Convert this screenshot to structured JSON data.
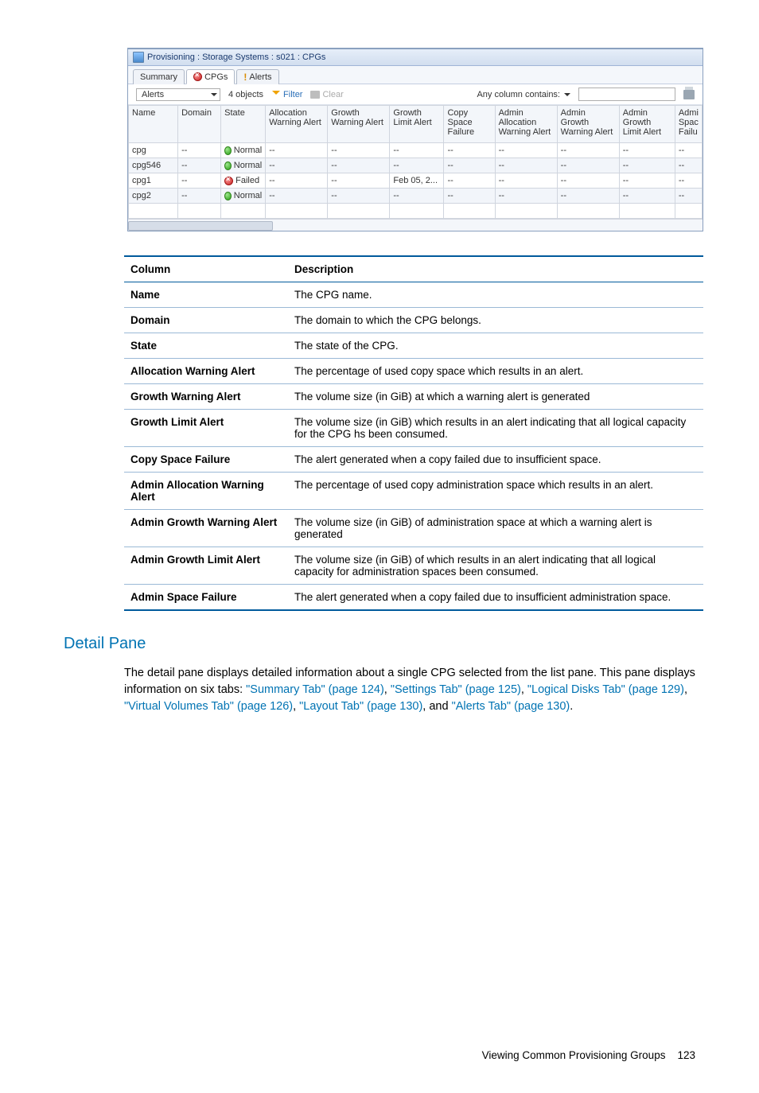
{
  "screenshot": {
    "title": "Provisioning : Storage Systems : s021 : CPGs",
    "tabs": [
      {
        "label": "Summary",
        "icon": "",
        "active": false
      },
      {
        "label": "CPGs",
        "icon": "red-x",
        "active": true
      },
      {
        "label": "Alerts",
        "icon": "bang",
        "active": false
      }
    ],
    "toolbar": {
      "dropdown_value": "Alerts",
      "object_count": "4 objects",
      "filter_label": "Filter",
      "clear_label": "Clear",
      "search_label": "Any column contains:",
      "search_value": ""
    },
    "columns": [
      "Name",
      "Domain",
      "State",
      "Allocation Warning Alert",
      "Growth Warning Alert",
      "Growth Limit Alert",
      "Copy Space Failure",
      "Admin Allocation Warning Alert",
      "Admin Growth Warning Alert",
      "Admin Growth Limit Alert",
      "Admi Spac Failu"
    ],
    "rows": [
      {
        "name": "cpg",
        "domain": "--",
        "state": "Normal",
        "state_icon": "green",
        "alloc": "--",
        "growthw": "--",
        "growthl": "--",
        "copy": "--",
        "aalloc": "--",
        "agrowthw": "--",
        "agrowthl": "--",
        "aspace": "--",
        "alt": false
      },
      {
        "name": "cpg546",
        "domain": "--",
        "state": "Normal",
        "state_icon": "green",
        "alloc": "--",
        "growthw": "--",
        "growthl": "--",
        "copy": "--",
        "aalloc": "--",
        "agrowthw": "--",
        "agrowthl": "--",
        "aspace": "--",
        "alt": true
      },
      {
        "name": "cpg1",
        "domain": "--",
        "state": "Failed",
        "state_icon": "red",
        "alloc": "--",
        "growthw": "--",
        "growthl": "Feb 05, 2...",
        "copy": "--",
        "aalloc": "--",
        "agrowthw": "--",
        "agrowthl": "--",
        "aspace": "--",
        "alt": false
      },
      {
        "name": "cpg2",
        "domain": "--",
        "state": "Normal",
        "state_icon": "green",
        "alloc": "--",
        "growthw": "--",
        "growthl": "--",
        "copy": "--",
        "aalloc": "--",
        "agrowthw": "--",
        "agrowthl": "--",
        "aspace": "--",
        "alt": true
      }
    ]
  },
  "desc_table": {
    "headers": {
      "col": "Column",
      "desc": "Description"
    },
    "rows": [
      {
        "col": "Name",
        "desc": "The CPG name."
      },
      {
        "col": "Domain",
        "desc": "The domain to which the CPG belongs."
      },
      {
        "col": "State",
        "desc": "The state of the CPG."
      },
      {
        "col": "Allocation Warning Alert",
        "desc": "The percentage of used copy space which results in an alert."
      },
      {
        "col": "Growth Warning Alert",
        "desc": "The volume size (in GiB) at which a warning alert is generated"
      },
      {
        "col": "Growth Limit Alert",
        "desc": "The volume size (in GiB) which results in an alert indicating that all logical capacity for the CPG hs been consumed."
      },
      {
        "col": "Copy Space Failure",
        "desc": "The alert generated when a copy failed due to insufficient space."
      },
      {
        "col": "Admin Allocation Warning Alert",
        "desc": "The percentage of used copy administration space which results in an alert."
      },
      {
        "col": "Admin Growth Warning Alert",
        "desc": "The volume size (in GiB) of administration space at which a warning alert is generated"
      },
      {
        "col": "Admin Growth Limit Alert",
        "desc": "The volume size (in GiB) of which results in an alert indicating that all logical capacity for administration spaces been consumed."
      },
      {
        "col": "Admin Space Failure",
        "desc": "The alert generated when a copy failed due to insufficient administration space."
      }
    ]
  },
  "section": {
    "heading": "Detail Pane",
    "para_parts": [
      "The detail pane displays detailed information about a single CPG selected from the list pane. This pane displays information on six tabs: ",
      ", ",
      ", ",
      ", ",
      ", ",
      ", and ",
      "."
    ],
    "links": [
      "\"Summary Tab\" (page 124)",
      "\"Settings Tab\" (page 125)",
      "\"Logical Disks Tab\" (page 129)",
      "\"Virtual Volumes Tab\" (page 126)",
      "\"Layout Tab\" (page 130)",
      "\"Alerts Tab\" (page 130)"
    ]
  },
  "footer": {
    "text": "Viewing Common Provisioning Groups",
    "page": "123"
  }
}
